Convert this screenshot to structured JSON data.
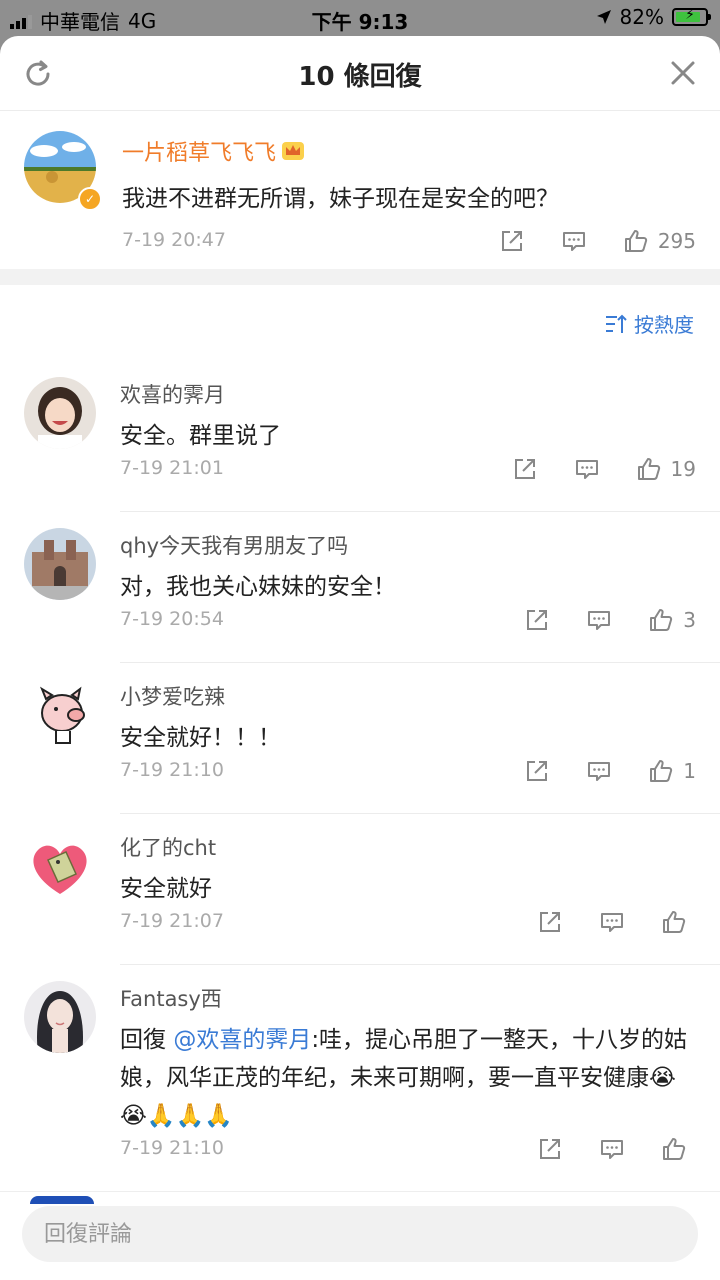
{
  "status_bar": {
    "carrier": "中華電信",
    "network": "4G",
    "time": "下午 9:13",
    "battery": "82%"
  },
  "header": {
    "title": "10 條回復"
  },
  "main_comment": {
    "author": "一片稻草飞飞飞",
    "text": "我进不进群无所谓，妹子现在是安全的吧？",
    "time": "7-19 20:47",
    "likes": "295"
  },
  "sort": {
    "label": "按熱度"
  },
  "replies": [
    {
      "author": "欢喜的霁月",
      "text": "安全。群里说了",
      "time": "7-19 21:01",
      "likes": "19"
    },
    {
      "author": "qhy今天我有男朋友了吗",
      "text": "对，我也关心妹妹的安全！",
      "time": "7-19 20:54",
      "likes": "3"
    },
    {
      "author": "小梦爱吃辣",
      "text": "安全就好！！！",
      "time": "7-19 21:10",
      "likes": "1"
    },
    {
      "author": "化了的cht",
      "text": "安全就好",
      "time": "7-19 21:07",
      "likes": ""
    },
    {
      "author": "Fantasy西",
      "text_prefix": "回復",
      "mention": "@欢喜的霁月",
      "text": ":哇，提心吊胆了一整天，十八岁的姑娘，风华正茂的年纪，未来可期啊，要一直平安健康",
      "emoji": "😭😭🙏🙏🙏",
      "time": "7-19 21:10",
      "likes": ""
    }
  ],
  "composer": {
    "placeholder": "回復評論"
  },
  "colors": {
    "author_vip": "#f07c2a",
    "link": "#3a7bd5",
    "meta": "#aaaaaa"
  }
}
